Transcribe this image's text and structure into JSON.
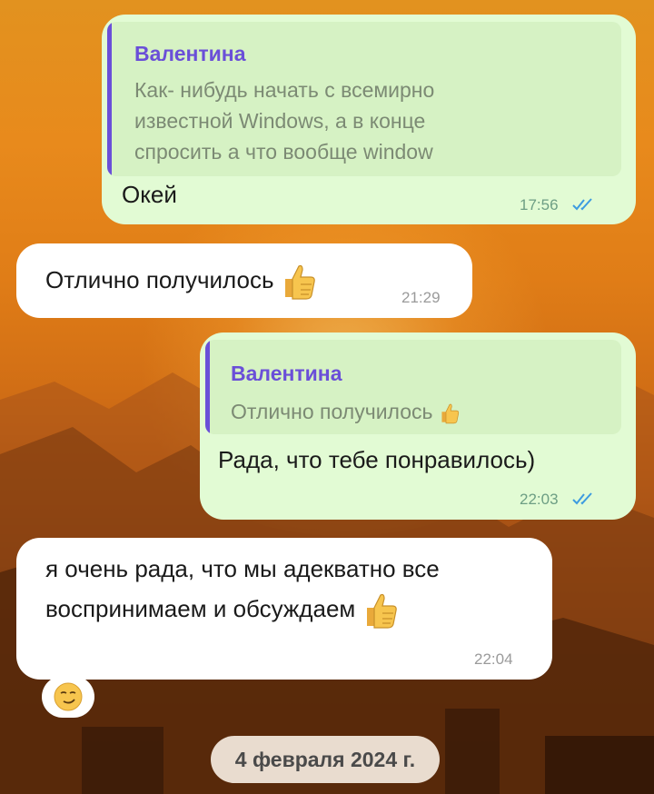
{
  "messages": [
    {
      "direction": "outgoing",
      "reply_to": {
        "name": "Валентина",
        "lines": [
          "Как- нибудь начать с всемирно",
          "известной Windows, а в конце",
          "спросить а что вообще window"
        ]
      },
      "text": "Окей",
      "time": "17:56",
      "status": "read"
    },
    {
      "direction": "incoming",
      "text": "Отлично получилось",
      "emoji": "thumbs-up",
      "time": "21:29"
    },
    {
      "direction": "outgoing",
      "reply_to": {
        "name": "Валентина",
        "lines": [
          "Отлично получилось"
        ],
        "emoji": "thumbs-up"
      },
      "text": "Рада, что тебе понравилось)",
      "time": "22:03",
      "status": "read"
    },
    {
      "direction": "incoming",
      "lines": [
        "я очень рада, что мы адекватно все",
        "воспринимаем и обсуждаем"
      ],
      "emoji": "thumbs-up",
      "time": "22:04",
      "reaction": "smirking-face"
    }
  ],
  "date_separator": "4 февраля 2024 г.",
  "colors": {
    "outgoing_bubble": "#e2fbd4",
    "incoming_bubble": "#ffffff",
    "reply_accent": "#6a4fd8",
    "read_ticks": "#3d9be0"
  }
}
